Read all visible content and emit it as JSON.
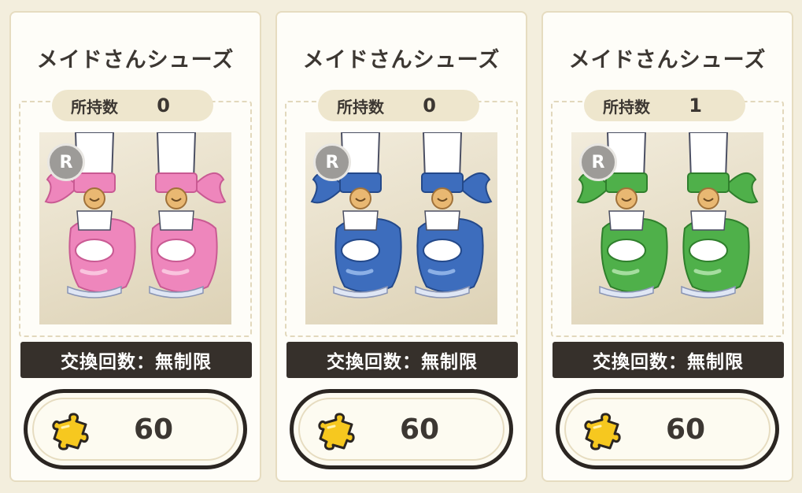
{
  "cards": [
    {
      "title": "メイドさんシューズ",
      "owned_label": "所持数",
      "owned_count": "0",
      "rarity": "R",
      "exchange_text": "交換回数：無制限",
      "price": "60",
      "color_main": "#ee86bc",
      "color_light": "#f9c4de",
      "color_dark": "#c95a93",
      "icon": "puzzle-piece-icon"
    },
    {
      "title": "メイドさんシューズ",
      "owned_label": "所持数",
      "owned_count": "0",
      "rarity": "R",
      "exchange_text": "交換回数：無制限",
      "price": "60",
      "color_main": "#3d6dbd",
      "color_light": "#8cb0e6",
      "color_dark": "#24498a",
      "icon": "puzzle-piece-icon"
    },
    {
      "title": "メイドさんシューズ",
      "owned_label": "所持数",
      "owned_count": "1",
      "rarity": "R",
      "exchange_text": "交換回数：無制限",
      "price": "60",
      "color_main": "#4fb04a",
      "color_light": "#a5dd9f",
      "color_dark": "#2f7f2c",
      "icon": "puzzle-piece-icon"
    }
  ]
}
